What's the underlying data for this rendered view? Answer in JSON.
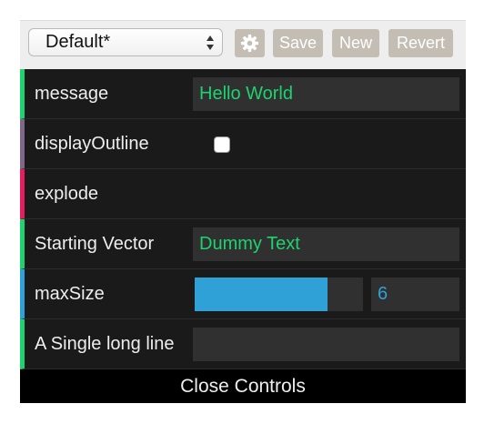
{
  "header": {
    "preset_value": "Default*",
    "gear_icon": "gear-icon",
    "save_label": "Save",
    "new_label": "New",
    "revert_label": "Revert"
  },
  "controllers": {
    "message": {
      "label": "message",
      "value": "Hello World"
    },
    "displayOutline": {
      "label": "displayOutline",
      "checked": false
    },
    "explode": {
      "label": "explode"
    },
    "startingVector": {
      "label": "Starting Vector",
      "value": "Dummy Text"
    },
    "maxSize": {
      "label": "maxSize",
      "value": "6",
      "fill_fraction": 0.79
    },
    "longLine": {
      "label": "A Single long line",
      "value": ""
    }
  },
  "footer": {
    "close_label": "Close Controls"
  },
  "colors": {
    "string": "#1ed36f",
    "boolean": "#806787",
    "function": "#e61d5f",
    "number": "#2fa1d6",
    "background": "#1a1a1a",
    "field": "#303030",
    "button": "#c3bdb3"
  }
}
